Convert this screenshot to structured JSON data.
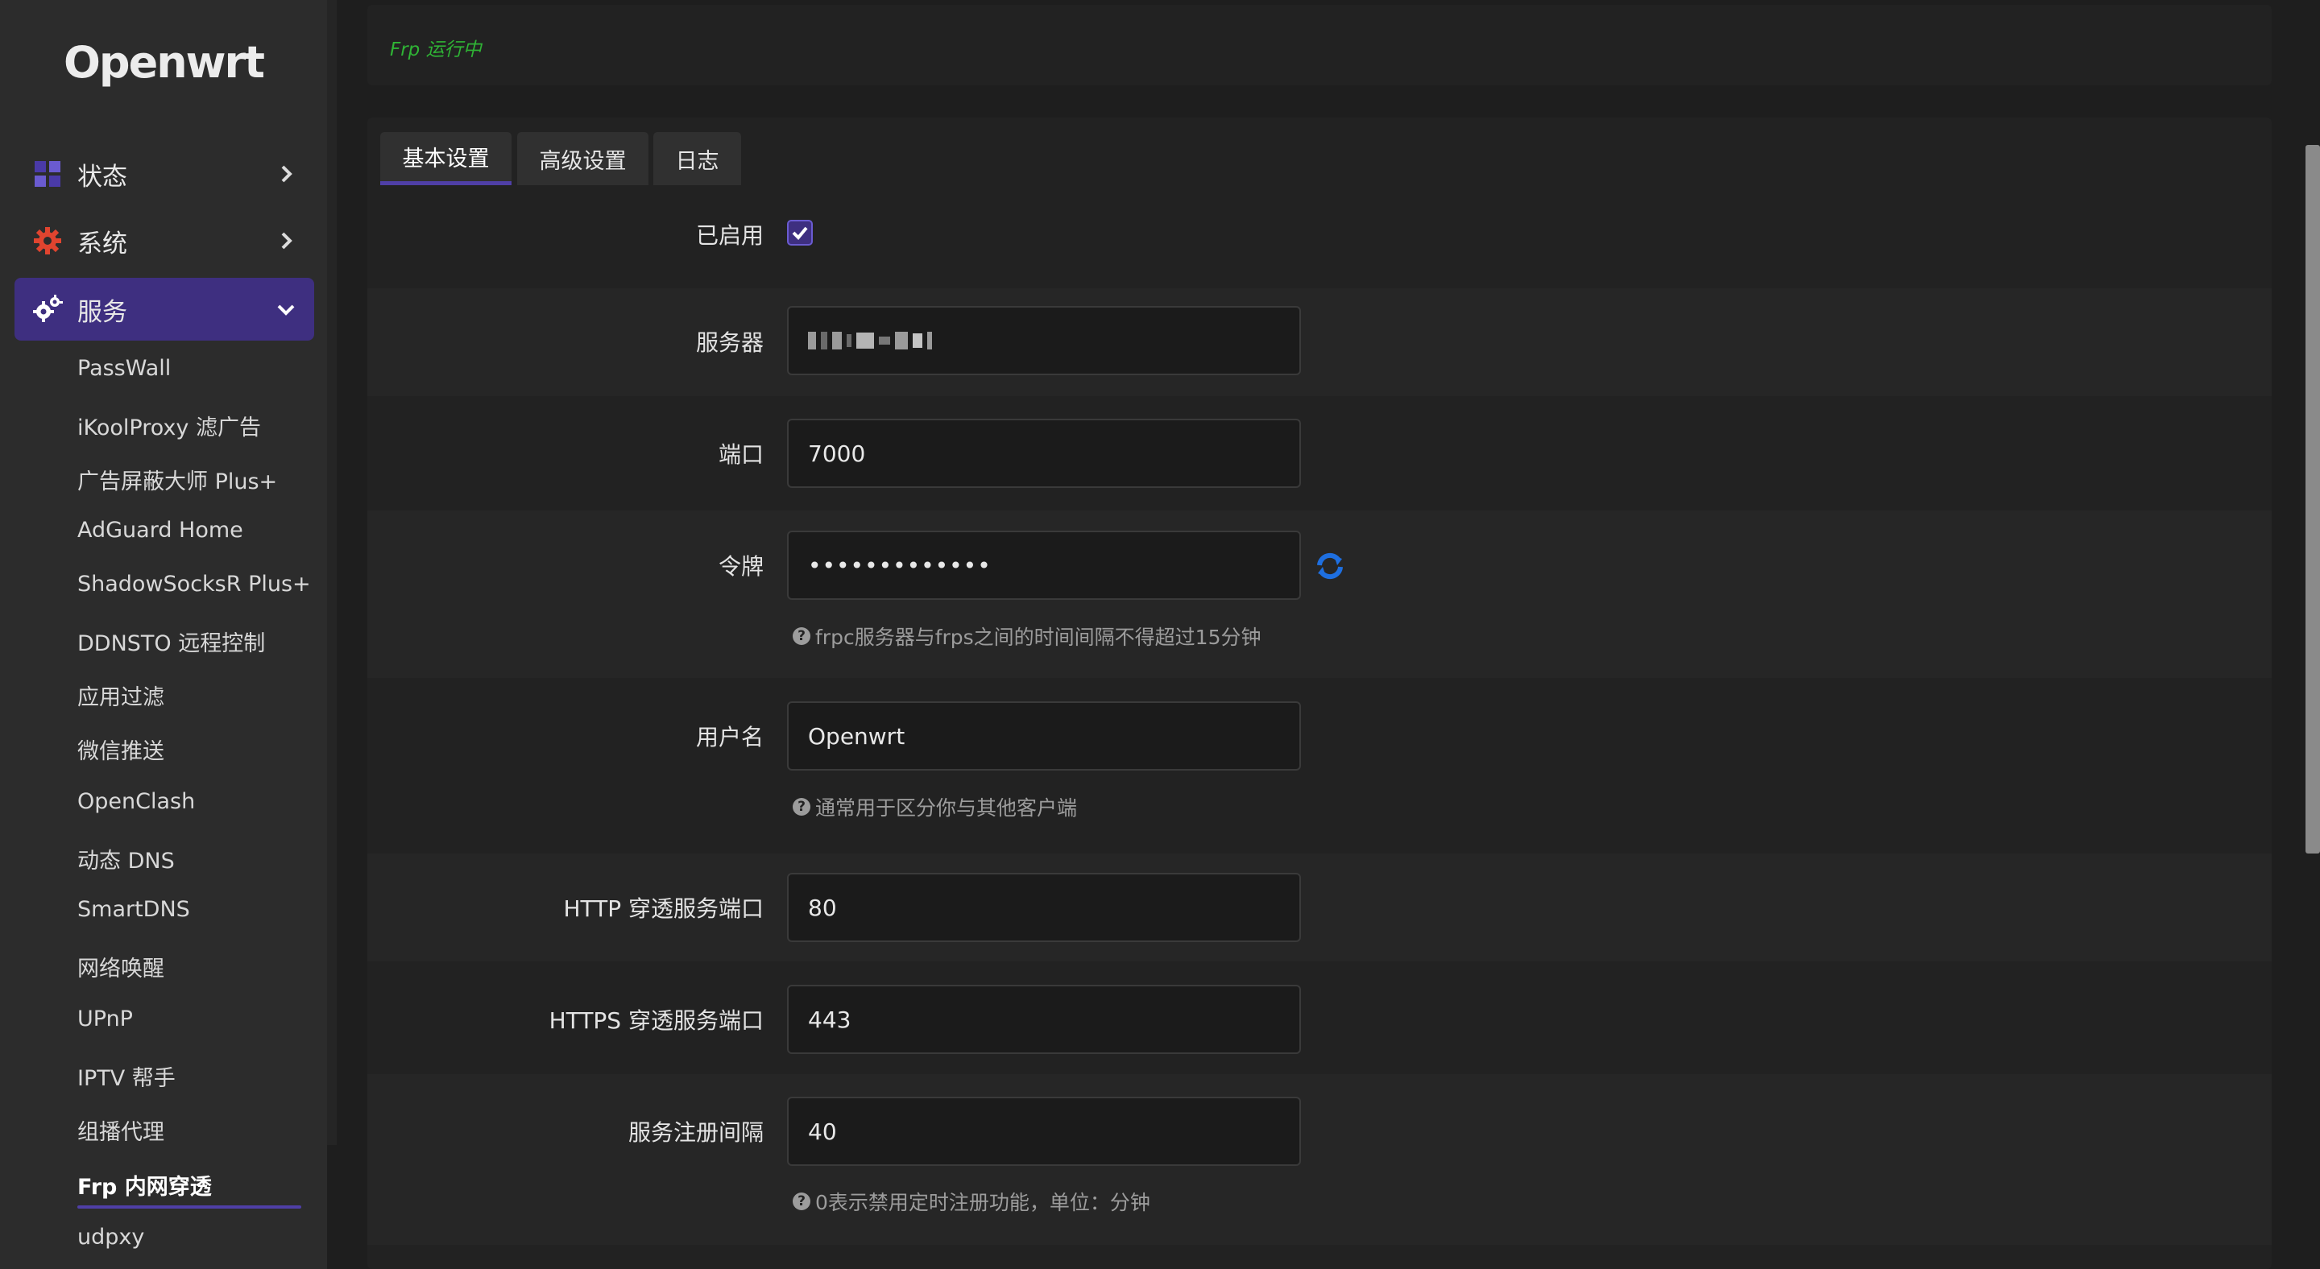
{
  "brand": {
    "logo": "Openwrt"
  },
  "sidebar": {
    "nav": [
      {
        "label": "状态",
        "icon": "dashboard-icon",
        "expanded": false
      },
      {
        "label": "系统",
        "icon": "gear-icon",
        "expanded": false
      },
      {
        "label": "服务",
        "icon": "services-gear-icon",
        "expanded": true
      }
    ],
    "services": [
      "PassWall",
      "iKoolProxy 滤广告",
      "广告屏蔽大师 Plus+",
      "AdGuard Home",
      "ShadowSocksR Plus+",
      "DDNSTO 远程控制",
      "应用过滤",
      "微信推送",
      "OpenClash",
      "动态 DNS",
      "SmartDNS",
      "网络唤醒",
      "UPnP",
      "IPTV 帮手",
      "组播代理",
      "Frp 内网穿透",
      "udpxy"
    ],
    "current_service": "Frp 内网穿透"
  },
  "status": {
    "text": "Frp 运行中",
    "color": "#2fb335"
  },
  "tabs": [
    {
      "label": "基本设置",
      "active": true
    },
    {
      "label": "高级设置",
      "active": false
    },
    {
      "label": "日志",
      "active": false
    }
  ],
  "form": {
    "enabled": {
      "label": "已启用",
      "checked": true
    },
    "server": {
      "label": "服务器",
      "value": ""
    },
    "port": {
      "label": "端口",
      "value": "7000"
    },
    "token": {
      "label": "令牌",
      "value": "•••••••••••••",
      "help": "frpc服务器与frps之间的时间间隔不得超过15分钟"
    },
    "username": {
      "label": "用户名",
      "value": "Openwrt",
      "help": "通常用于区分你与其他客户端"
    },
    "http_port": {
      "label": "HTTP 穿透服务端口",
      "value": "80"
    },
    "https_port": {
      "label": "HTTPS 穿透服务端口",
      "value": "443"
    },
    "register_interval": {
      "label": "服务注册间隔",
      "value": "40",
      "help": "0表示禁用定时注册功能，单位：分钟"
    }
  },
  "colors": {
    "accent": "#3e2f80",
    "accent_line": "#4f3fa6",
    "background": "#1e1e1e",
    "sidebar": "#2c2c2c",
    "link_icon": "#1e6fe0"
  }
}
